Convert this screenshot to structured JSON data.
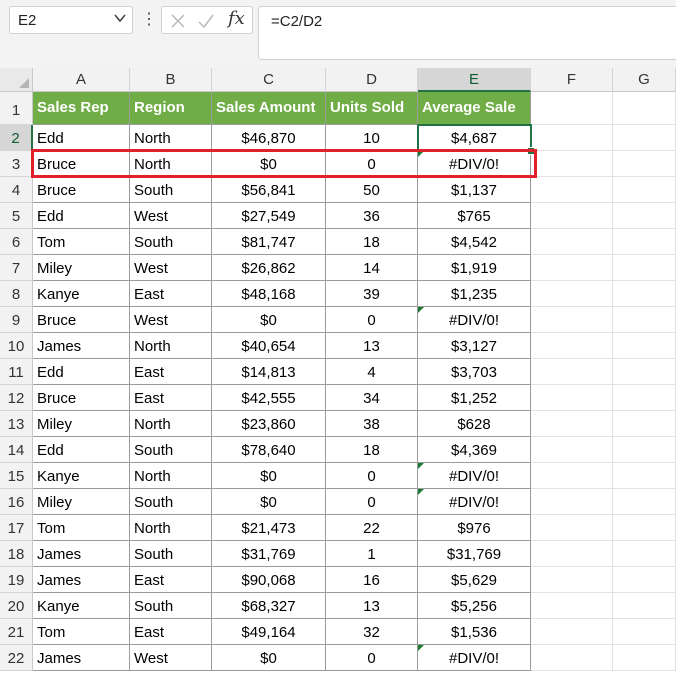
{
  "formula_bar": {
    "name_box": "E2",
    "formula": "=C2/D2",
    "fx_label": "fx"
  },
  "columns": [
    "A",
    "B",
    "C",
    "D",
    "E",
    "F",
    "G"
  ],
  "selected_column": "E",
  "selected_row": 2,
  "header": [
    "Sales Rep",
    "Region",
    "Sales Amount",
    "Units Sold",
    "Average Sale"
  ],
  "rows": [
    {
      "num": 2,
      "rep": "Edd",
      "region": "North",
      "amount": "$46,870",
      "units": "10",
      "avg": "$4,687",
      "error": false
    },
    {
      "num": 3,
      "rep": "Bruce",
      "region": "North",
      "amount": "$0",
      "units": "0",
      "avg": "#DIV/0!",
      "error": true
    },
    {
      "num": 4,
      "rep": "Bruce",
      "region": "South",
      "amount": "$56,841",
      "units": "50",
      "avg": "$1,137",
      "error": false
    },
    {
      "num": 5,
      "rep": "Edd",
      "region": "West",
      "amount": "$27,549",
      "units": "36",
      "avg": "$765",
      "error": false
    },
    {
      "num": 6,
      "rep": "Tom",
      "region": "South",
      "amount": "$81,747",
      "units": "18",
      "avg": "$4,542",
      "error": false
    },
    {
      "num": 7,
      "rep": "Miley",
      "region": "West",
      "amount": "$26,862",
      "units": "14",
      "avg": "$1,919",
      "error": false
    },
    {
      "num": 8,
      "rep": "Kanye",
      "region": "East",
      "amount": "$48,168",
      "units": "39",
      "avg": "$1,235",
      "error": false
    },
    {
      "num": 9,
      "rep": "Bruce",
      "region": "West",
      "amount": "$0",
      "units": "0",
      "avg": "#DIV/0!",
      "error": true
    },
    {
      "num": 10,
      "rep": "James",
      "region": "North",
      "amount": "$40,654",
      "units": "13",
      "avg": "$3,127",
      "error": false
    },
    {
      "num": 11,
      "rep": "Edd",
      "region": "East",
      "amount": "$14,813",
      "units": "4",
      "avg": "$3,703",
      "error": false
    },
    {
      "num": 12,
      "rep": "Bruce",
      "region": "East",
      "amount": "$42,555",
      "units": "34",
      "avg": "$1,252",
      "error": false
    },
    {
      "num": 13,
      "rep": "Miley",
      "region": "North",
      "amount": "$23,860",
      "units": "38",
      "avg": "$628",
      "error": false
    },
    {
      "num": 14,
      "rep": "Edd",
      "region": "South",
      "amount": "$78,640",
      "units": "18",
      "avg": "$4,369",
      "error": false
    },
    {
      "num": 15,
      "rep": "Kanye",
      "region": "North",
      "amount": "$0",
      "units": "0",
      "avg": "#DIV/0!",
      "error": true
    },
    {
      "num": 16,
      "rep": "Miley",
      "region": "South",
      "amount": "$0",
      "units": "0",
      "avg": "#DIV/0!",
      "error": true
    },
    {
      "num": 17,
      "rep": "Tom",
      "region": "North",
      "amount": "$21,473",
      "units": "22",
      "avg": "$976",
      "error": false
    },
    {
      "num": 18,
      "rep": "James",
      "region": "South",
      "amount": "$31,769",
      "units": "1",
      "avg": "$31,769",
      "error": false
    },
    {
      "num": 19,
      "rep": "James",
      "region": "East",
      "amount": "$90,068",
      "units": "16",
      "avg": "$5,629",
      "error": false
    },
    {
      "num": 20,
      "rep": "Kanye",
      "region": "South",
      "amount": "$68,327",
      "units": "13",
      "avg": "$5,256",
      "error": false
    },
    {
      "num": 21,
      "rep": "Tom",
      "region": "East",
      "amount": "$49,164",
      "units": "32",
      "avg": "$1,536",
      "error": false
    },
    {
      "num": 22,
      "rep": "James",
      "region": "West",
      "amount": "$0",
      "units": "0",
      "avg": "#DIV/0!",
      "error": true
    }
  ],
  "highlighted_row": 3,
  "colors": {
    "header_fill": "#70ad47",
    "selection": "#217346",
    "highlight_box": "#e0202a",
    "error_indicator": "#1e7b32"
  }
}
